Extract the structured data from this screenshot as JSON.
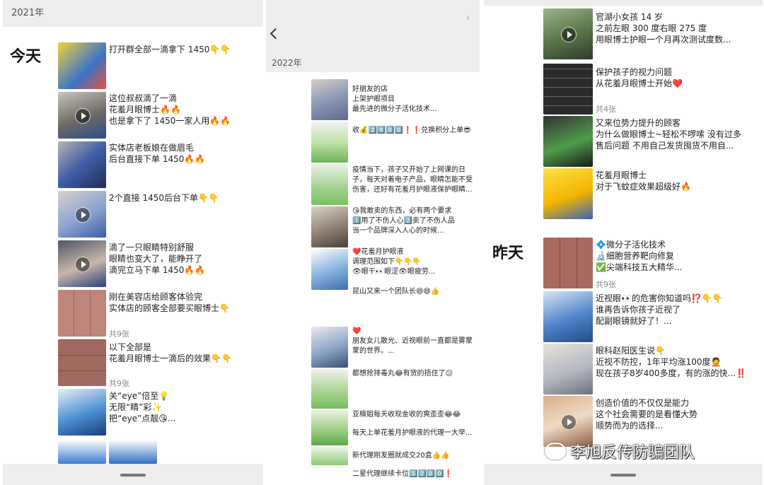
{
  "panel1": {
    "year": "2021年",
    "day_label": "今天",
    "posts": [
      {
        "lines": [
          "打开群全部一滴拿下 1450👇👇"
        ]
      },
      {
        "lines": [
          "这位叔叔滴了一滴",
          "花羞月眼博士🔥🔥",
          "也是拿下了 1450一家人用🔥🔥"
        ]
      },
      {
        "lines": [
          "实体店老板娘在做眉毛",
          "后台直接下单 1450🔥🔥"
        ]
      },
      {
        "lines": [
          "2个直接 1450后台下单👇👇"
        ]
      },
      {
        "lines": [
          "滴了一只眼睛特别舒服",
          "眼睛也变大了，能睁开了",
          "滴完立马下单 1450🔥🔥"
        ]
      },
      {
        "lines": [
          "刚在美容店给顾客体验完",
          "实体店的顾客全部要买眼博士👇"
        ]
      },
      {
        "lines": [
          "以下全部是",
          "花羞月眼博士一滴后的效果👇👇"
        ]
      },
      {
        "lines": [
          "关“eye”倍至💡",
          "无限“睛”彩✨",
          "把“eye”点靓😘..."
        ]
      }
    ],
    "counts": [
      "共9张",
      "共9张"
    ]
  },
  "panel2": {
    "year": "2022年",
    "posts": [
      {
        "lines": [
          "好朋友的店",
          "上架护眼项目",
          "最先进的微分子活化技术..."
        ]
      },
      {
        "lines": [
          "收💰2️⃣9️⃣0️⃣0️⃣❗❗兑换积分上单😎"
        ]
      },
      {
        "lines": [
          "疫情当下，孩子又开始了上网课的日",
          "子，每天对着电子产品，眼睛怎能不受",
          "伤害，还好有花羞月护眼液保护眼睛..."
        ]
      },
      {
        "lines": [
          "😘我敢卖的东西，必有两个要求",
          "1️⃣用了不伤人心2️⃣卖了不伤人品",
          "当一个品牌深入人心的时候..."
        ]
      },
      {
        "lines": [
          "❤️花羞月护眼液",
          "调理范围如下👇👇👇",
          "👁眼干👀眼涩👁眼疲劳..."
        ]
      },
      {
        "lines": [
          "昆山又来一个团队长😄😄👍"
        ]
      },
      {
        "lines": [
          "❤️",
          "朋友女儿散光、近视眼前一直都是雾蒙",
          "蒙的世界。..."
        ]
      },
      {
        "lines": [
          "都想抢排毒丸😂有货的捂住了😕"
        ]
      },
      {
        "lines": [
          "亚楠姐每天收现金收的爽歪歪😂😂"
        ]
      },
      {
        "lines": [
          "每天上单花羞月护眼液的代理一大早..."
        ]
      },
      {
        "lines": [
          "新代理刚发圈就成交20盒👍👍"
        ]
      },
      {
        "lines": [
          "二星代理继续卡位5️⃣2️⃣0️⃣0️⃣❗"
        ]
      }
    ]
  },
  "panel3": {
    "day_label": "昨天",
    "posts": [
      {
        "lines": [
          "官湖小女孩 14 岁",
          "之前左眼 300 度右眼 275 度",
          "用眼博士护眼一个月再次测试度数..."
        ]
      },
      {
        "lines": [
          "保护孩子的视力问题",
          "从花羞月眼博士开始❤️"
        ]
      },
      {
        "lines": [
          "又来位势力提升的顾客",
          "为什么做眼博士~轻松不啰嗦 没有过多",
          "售后问题  不用自己发货囤货不用自..."
        ]
      },
      {
        "lines": [
          "花羞月眼博士",
          "对于飞蚊症效果超级好🔥"
        ]
      },
      {
        "lines": [
          "💠微分子活化技术",
          "🔬细胞营养靶向修复",
          "✅尖端科技五大精华..."
        ]
      },
      {
        "lines": [
          "近视眼👀的危害你知道吗⁉️👇👇",
          "谁再告诉你孩子近视了",
          "配副眼镜就好了！..."
        ]
      },
      {
        "lines": [
          "眼科赵阳医生说👇",
          "近视不防控，1年平均涨100度🤦",
          "现在孩子8岁400多度，有的涨的快...‼️"
        ]
      },
      {
        "lines": [
          "创造价值的不仅仅是能力",
          "这个社会需要的是看懂大势",
          "顺势而为的选择..."
        ]
      }
    ],
    "counts": [
      "共4张",
      "共9张"
    ],
    "watermark": "李旭反传防骗团队"
  },
  "colors": {
    "bar": "#ededed",
    "text": "#222222",
    "muted": "#888888"
  }
}
